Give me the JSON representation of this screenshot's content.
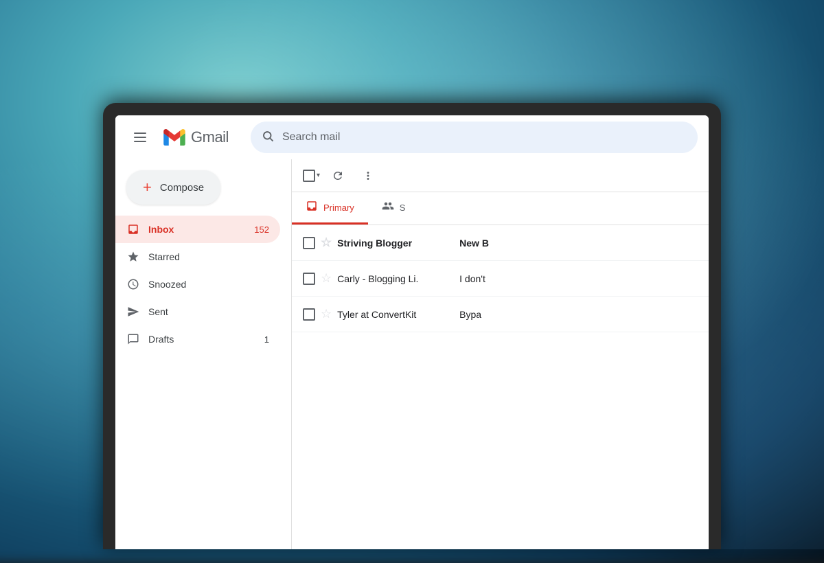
{
  "background": {
    "description": "blurry teal blue water aerial photo"
  },
  "header": {
    "menu_label": "Main menu",
    "logo_text": "Gmail",
    "search_placeholder": "Search mail"
  },
  "sidebar": {
    "compose_label": "Compose",
    "nav_items": [
      {
        "id": "inbox",
        "label": "Inbox",
        "icon": "inbox",
        "badge": "152",
        "active": true
      },
      {
        "id": "starred",
        "label": "Starred",
        "icon": "star",
        "badge": "",
        "active": false
      },
      {
        "id": "snoozed",
        "label": "Snoozed",
        "icon": "clock",
        "badge": "",
        "active": false
      },
      {
        "id": "sent",
        "label": "Sent",
        "icon": "send",
        "badge": "",
        "active": false
      },
      {
        "id": "drafts",
        "label": "Drafts",
        "icon": "draft",
        "badge": "1",
        "active": false
      }
    ]
  },
  "toolbar": {
    "select_label": "Select",
    "refresh_label": "Refresh",
    "more_label": "More"
  },
  "tabs": [
    {
      "id": "primary",
      "label": "Primary",
      "icon": "inbox",
      "active": true
    },
    {
      "id": "social",
      "label": "S",
      "icon": "people",
      "active": false
    }
  ],
  "emails": [
    {
      "sender": "Striving Blogger",
      "subject": "New B",
      "unread": true
    },
    {
      "sender": "Carly - Blogging Li.",
      "subject": "I don't",
      "unread": false
    },
    {
      "sender": "Tyler at ConvertKit",
      "subject": "Bypa",
      "unread": false
    }
  ]
}
